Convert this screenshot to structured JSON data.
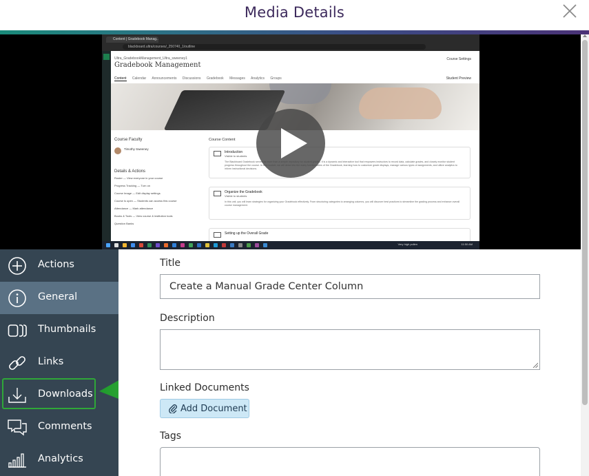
{
  "header": {
    "title": "Media Details"
  },
  "video": {
    "browser_tab": "Content | Gradebook Manag...",
    "browser_url": "blackboard.ultra/courses/_250740_1/outline",
    "course_breadcrumb": "Ultra_GradebookManagement_Ultra_sweeney1",
    "course_title": "Gradebook Management",
    "course_settings": "Course Settings",
    "course_nav": [
      "Content",
      "Calendar",
      "Announcements",
      "Discussions",
      "Gradebook",
      "Messages",
      "Analytics",
      "Groups"
    ],
    "student_preview": "Student Preview",
    "faculty_heading": "Course Faculty",
    "faculty_name": "Timothy Sweeney",
    "details_heading": "Details & Actions",
    "details_rows": [
      "Roster — View everyone in your course",
      "Progress Tracking — Turn on",
      "Course Image — Edit display settings",
      "Course is open — Students can access this course",
      "Attendance — Mark attendance",
      "Books & Tools — View course & institution tools",
      "Question Banks"
    ],
    "content_heading": "Course Content",
    "content_items": [
      {
        "title": "Introduction",
        "visibility": "Visible to students",
        "desc": "The Blackboard Gradebook serves as more than a simple repository for student grades. It is a dynamic and interactive tool that empowers instructors to record data, calculate grades, and closely monitor student progress throughout the course. In this module, we will delve into the many functionalities of the Gradebook, learning how to customize grade displays, manage various types of assignments, and utilize analytics to inform instructional decisions."
      },
      {
        "title": "Organize the Gradebook",
        "visibility": "Visible to students",
        "desc": "In this unit, you will learn strategies for organizing your Gradebook effectively. From structuring categories to arranging columns, you will discover best practices to streamline the grading process and enhance overall course management."
      },
      {
        "title": "Setting up the Overall Grade",
        "visibility": "",
        "desc": ""
      }
    ],
    "taskbar_status": "Very high pollen",
    "taskbar_time": "11:50 AM"
  },
  "menu": {
    "items": [
      {
        "label": "Actions",
        "icon": "plus-circle-icon"
      },
      {
        "label": "General",
        "icon": "info-circle-icon"
      },
      {
        "label": "Thumbnails",
        "icon": "thumbnails-icon"
      },
      {
        "label": "Links",
        "icon": "link-icon"
      },
      {
        "label": "Downloads",
        "icon": "download-icon"
      },
      {
        "label": "Comments",
        "icon": "comments-icon"
      },
      {
        "label": "Analytics",
        "icon": "analytics-icon"
      }
    ],
    "active": "General",
    "highlighted": "Downloads"
  },
  "form": {
    "title_label": "Title",
    "title_value": "Create a Manual Grade Center Column",
    "description_label": "Description",
    "description_value": "",
    "linked_label": "Linked Documents",
    "add_document_label": "Add Document",
    "tags_label": "Tags"
  },
  "colors": {
    "menu_bg": "#354552",
    "menu_active": "#5a7184",
    "title_color": "#3d2a5c",
    "highlight_green": "#2fa838",
    "add_doc_bg": "#cde8f6"
  }
}
